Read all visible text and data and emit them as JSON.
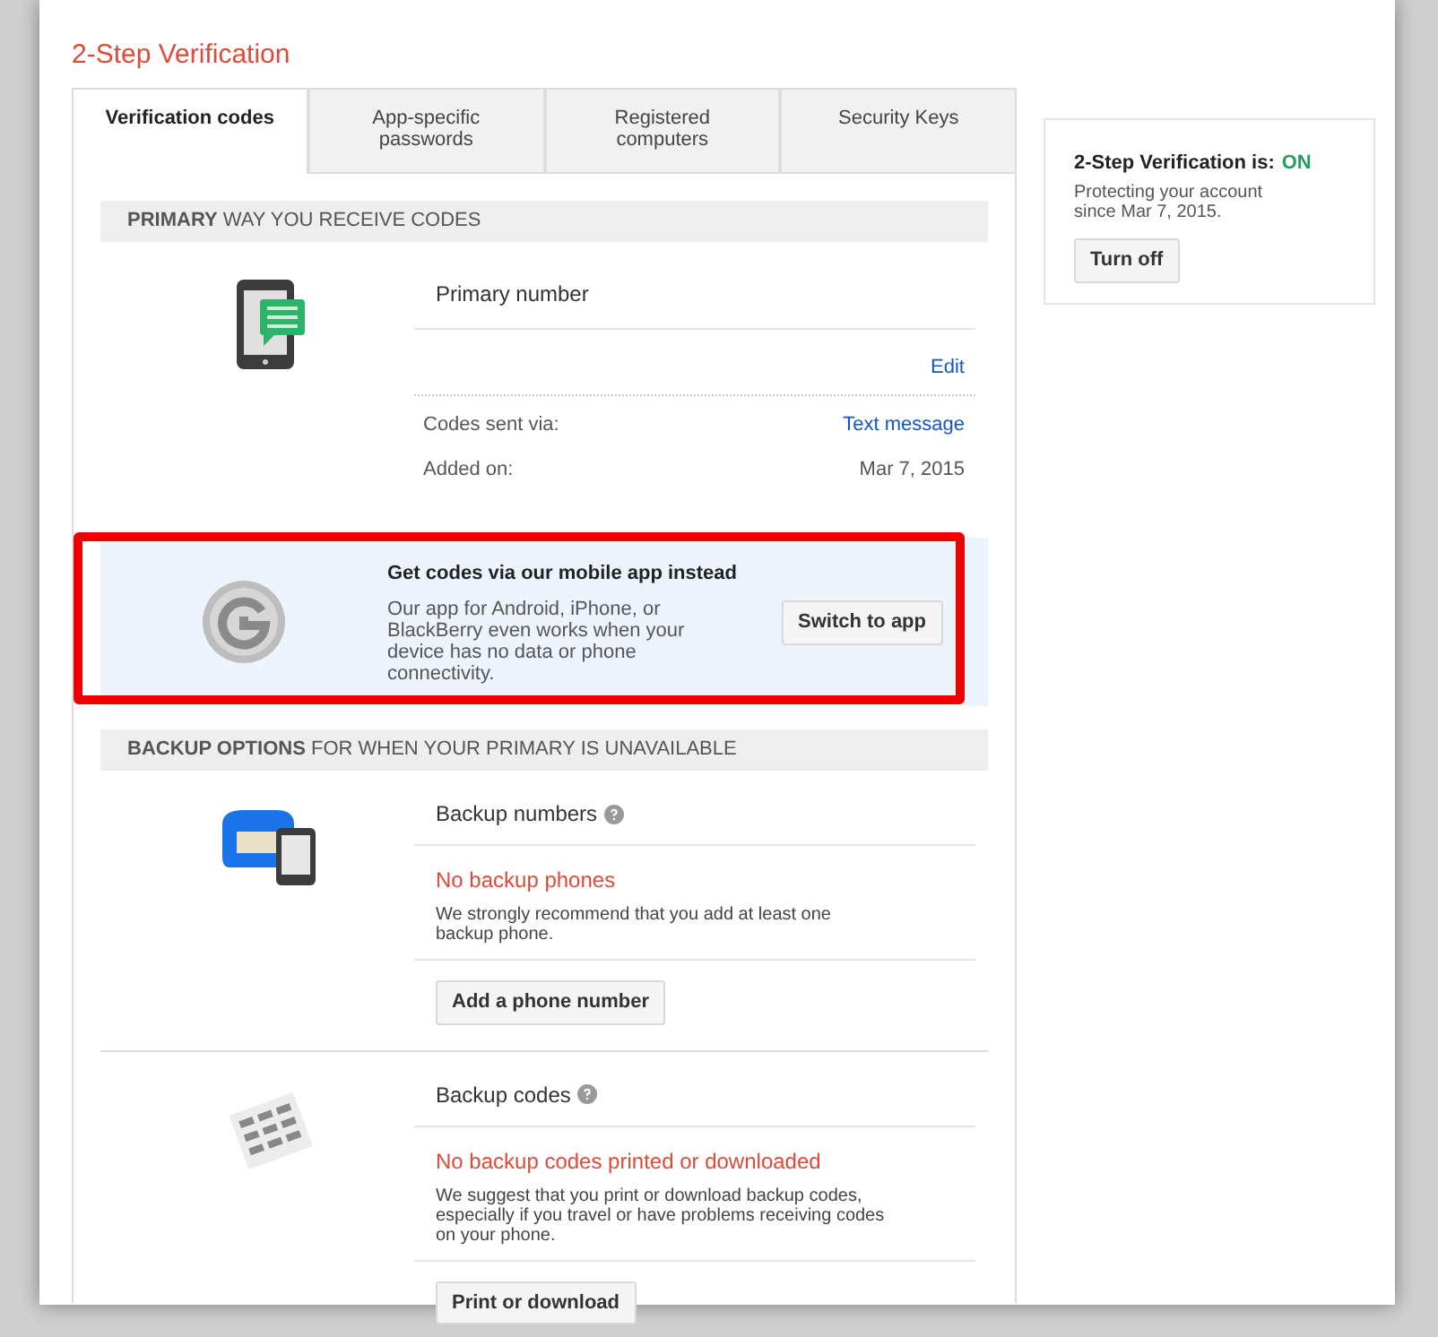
{
  "title": "2-Step Verification",
  "tabs": [
    {
      "label": "Verification codes",
      "selected": true
    },
    {
      "label": "App-specific passwords",
      "selected": false
    },
    {
      "label": "Registered computers",
      "selected": false
    },
    {
      "label": "Security Keys",
      "selected": false
    }
  ],
  "primary": {
    "heading": "**PRIMARY** WAY YOU RECEIVE CODES",
    "label": "Primary number",
    "edit_link": "Edit",
    "details": [
      {
        "label": "Codes sent via:",
        "value": "Text message",
        "kind": "link"
      },
      {
        "label": "Added on:",
        "value": "Mar 7, 2015",
        "kind": "text"
      }
    ]
  },
  "app_promo": {
    "title": "Get codes via our mobile app instead",
    "body": "Our app for Android, iPhone, or BlackBerry even works when your device has no data or phone connectivity.",
    "button": "Switch to app",
    "highlighted": true
  },
  "backup": {
    "heading": "**BACKUP OPTIONS** FOR WHEN YOUR PRIMARY IS UNAVAILABLE",
    "items": [
      {
        "kind": "phones",
        "label": "Backup numbers",
        "status": "No backup phones",
        "body": "We strongly recommend that you add at least one backup phone.",
        "button": "Add a phone number"
      },
      {
        "kind": "codes",
        "label": "Backup codes",
        "status": "No backup codes printed or downloaded",
        "body": "We suggest that you print or download backup codes, especially if you travel or have problems receiving codes on your phone.",
        "button": "Print or download"
      }
    ]
  },
  "status_card": {
    "label": "2-Step Verification is:",
    "state": "ON",
    "on": true,
    "body": "Protecting your account since Mar 7, 2015.",
    "button": "Turn off"
  }
}
